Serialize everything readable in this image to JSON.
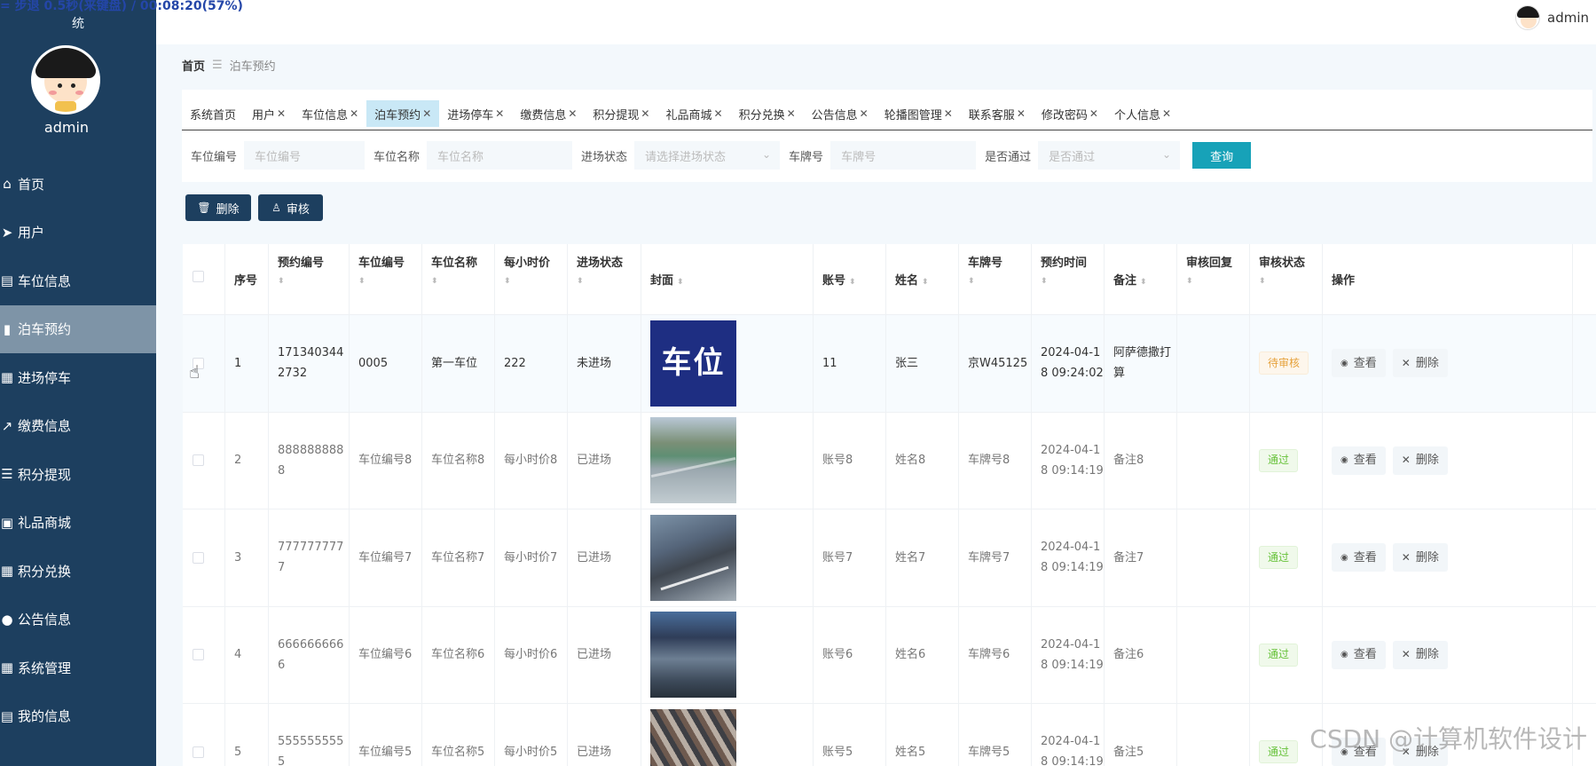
{
  "overlay": "= 步退 0.5秒(来键盘) / 00:08:20(57%)",
  "sidebar": {
    "system_title_end": "统",
    "username": "admin",
    "items": [
      {
        "label": "首页",
        "icon": "home-icon",
        "glyph": "⌂"
      },
      {
        "label": "用户",
        "icon": "send-icon",
        "glyph": "➤"
      },
      {
        "label": "车位信息",
        "icon": "clipboard-icon",
        "glyph": "▤"
      },
      {
        "label": "泊车预约",
        "icon": "bar-chart-icon",
        "glyph": "▮"
      },
      {
        "label": "进场停车",
        "icon": "grid-icon",
        "glyph": "▦"
      },
      {
        "label": "缴费信息",
        "icon": "line-chart-icon",
        "glyph": "↗"
      },
      {
        "label": "积分提现",
        "icon": "sliders-icon",
        "glyph": "☰"
      },
      {
        "label": "礼品商城",
        "icon": "shop-icon",
        "glyph": "▣"
      },
      {
        "label": "积分兑换",
        "icon": "grid-icon",
        "glyph": "▦"
      },
      {
        "label": "公告信息",
        "icon": "bulb-icon",
        "glyph": "●"
      },
      {
        "label": "系统管理",
        "icon": "grid-icon",
        "glyph": "▦"
      },
      {
        "label": "我的信息",
        "icon": "id-card-icon",
        "glyph": "▤"
      }
    ],
    "active_index": 3
  },
  "topbar": {
    "username": "admin"
  },
  "breadcrumb": {
    "home": "首页",
    "separator": "☰",
    "current": "泊车预约"
  },
  "tabs": [
    {
      "label": "系统首页",
      "closable": false
    },
    {
      "label": "用户",
      "closable": true
    },
    {
      "label": "车位信息",
      "closable": true
    },
    {
      "label": "泊车预约",
      "closable": true,
      "active": true
    },
    {
      "label": "进场停车",
      "closable": true
    },
    {
      "label": "缴费信息",
      "closable": true
    },
    {
      "label": "积分提现",
      "closable": true
    },
    {
      "label": "礼品商城",
      "closable": true
    },
    {
      "label": "积分兑换",
      "closable": true
    },
    {
      "label": "公告信息",
      "closable": true
    },
    {
      "label": "轮播图管理",
      "closable": true
    },
    {
      "label": "联系客服",
      "closable": true
    },
    {
      "label": "修改密码",
      "closable": true
    },
    {
      "label": "个人信息",
      "closable": true
    }
  ],
  "filters": {
    "parking_no": {
      "label": "车位编号",
      "placeholder": "车位编号"
    },
    "parking_name": {
      "label": "车位名称",
      "placeholder": "车位名称"
    },
    "entry_status": {
      "label": "进场状态",
      "placeholder": "请选择进场状态"
    },
    "plate": {
      "label": "车牌号",
      "placeholder": "车牌号"
    },
    "approved": {
      "label": "是否通过",
      "placeholder": "是否通过"
    },
    "query_label": "查询"
  },
  "actions": {
    "delete_label": "删除",
    "audit_label": "审核"
  },
  "table": {
    "headers": {
      "index": "序号",
      "booking_no": "预约编号",
      "parking_no": "车位编号",
      "parking_name": "车位名称",
      "hourly_price": "每小时价",
      "entry_status": "进场状态",
      "cover": "封面",
      "account": "账号",
      "name": "姓名",
      "plate": "车牌号",
      "booking_time": "预约时间",
      "note": "备注",
      "audit_reply": "审核回复",
      "audit_status": "审核状态",
      "ops": "操作"
    },
    "view_label": "查看",
    "delete_label": "删除",
    "rows": [
      {
        "index": "1",
        "booking_no": "1713403442732",
        "parking_no": "0005",
        "parking_name": "第一车位",
        "hourly_price": "222",
        "entry_status": "未进场",
        "cover_text": "车位",
        "account": "11",
        "name": "张三",
        "plate": "京W45125",
        "booking_time": "2024-04-18 09:24:02",
        "note": "阿萨德撒打算",
        "audit_reply": "",
        "audit_status": "待审核",
        "status_kind": "warn"
      },
      {
        "index": "2",
        "booking_no": "8888888888",
        "parking_no": "车位编号8",
        "parking_name": "车位名称8",
        "hourly_price": "每小时价8",
        "entry_status": "已进场",
        "cover_text": "",
        "account": "账号8",
        "name": "姓名8",
        "plate": "车牌号8",
        "booking_time": "2024-04-18 09:14:19",
        "note": "备注8",
        "audit_reply": "",
        "audit_status": "通过",
        "status_kind": "ok"
      },
      {
        "index": "3",
        "booking_no": "7777777777",
        "parking_no": "车位编号7",
        "parking_name": "车位名称7",
        "hourly_price": "每小时价7",
        "entry_status": "已进场",
        "cover_text": "",
        "account": "账号7",
        "name": "姓名7",
        "plate": "车牌号7",
        "booking_time": "2024-04-18 09:14:19",
        "note": "备注7",
        "audit_reply": "",
        "audit_status": "通过",
        "status_kind": "ok"
      },
      {
        "index": "4",
        "booking_no": "6666666666",
        "parking_no": "车位编号6",
        "parking_name": "车位名称6",
        "hourly_price": "每小时价6",
        "entry_status": "已进场",
        "cover_text": "",
        "account": "账号6",
        "name": "姓名6",
        "plate": "车牌号6",
        "booking_time": "2024-04-18 09:14:19",
        "note": "备注6",
        "audit_reply": "",
        "audit_status": "通过",
        "status_kind": "ok"
      },
      {
        "index": "5",
        "booking_no": "5555555555",
        "parking_no": "车位编号5",
        "parking_name": "车位名称5",
        "hourly_price": "每小时价5",
        "entry_status": "已进场",
        "cover_text": "",
        "account": "账号5",
        "name": "姓名5",
        "plate": "车牌号5",
        "booking_time": "2024-04-18 09:14:19",
        "note": "备注5",
        "audit_reply": "",
        "audit_status": "通过",
        "status_kind": "ok"
      }
    ]
  },
  "watermark": "CSDN @计算机软件设计"
}
